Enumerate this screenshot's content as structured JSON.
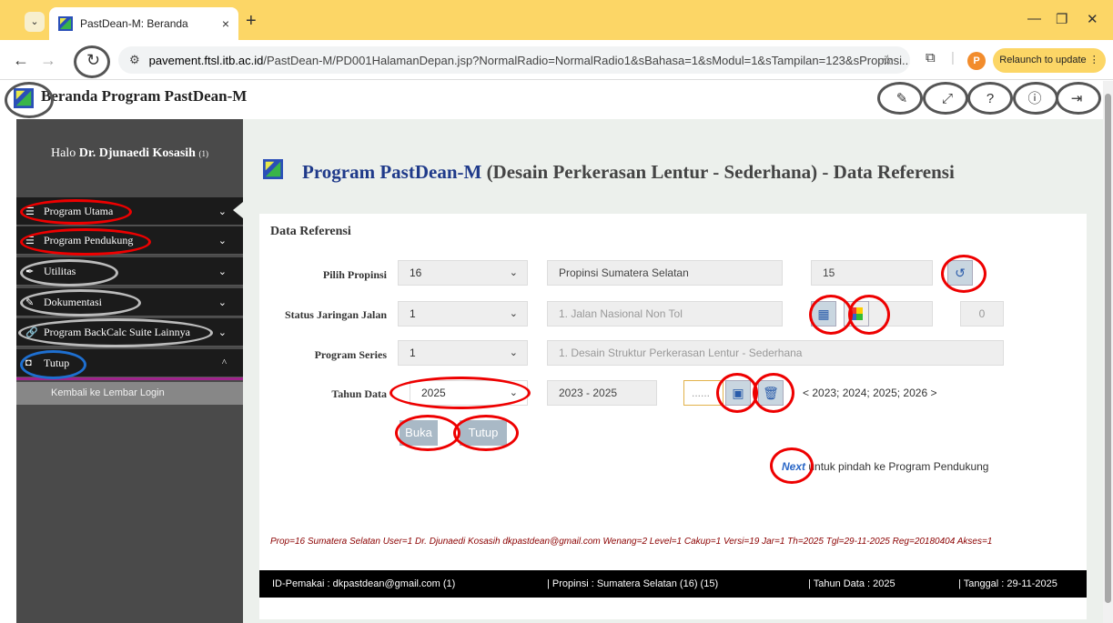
{
  "browser": {
    "tab_title": "PastDean-M: Beranda",
    "tab_close": "×",
    "new_tab": "+",
    "url_domain": "pavement.ftsl.itb.ac.id",
    "url_path": "/PastDean-M/PD001HalamanDepan.jsp?NormalRadio=NormalRadio1&sBahasa=1&sModul=1&sTampilan=123&sPropinsi...",
    "avatar_letter": "P",
    "relaunch_label": "Relaunch to update ⋮"
  },
  "app": {
    "title": "Beranda Program PastDean-M"
  },
  "sidebar": {
    "greeting": "Halo ",
    "user_name": "Dr. Djunaedi Kosasih",
    "user_id": "(1)",
    "items": [
      {
        "label": "Program Utama",
        "icon": "list-icon"
      },
      {
        "label": "Program Pendukung",
        "icon": "list-icon"
      },
      {
        "label": "Utilitas",
        "icon": "feather-icon"
      },
      {
        "label": "Dokumentasi",
        "icon": "pencil-icon"
      },
      {
        "label": "Program BackCalc Suite Lainnya",
        "icon": "link-icon"
      },
      {
        "label": "Tutup",
        "icon": "stop-icon"
      }
    ],
    "sub_item": "Kembali ke Lembar Login"
  },
  "main": {
    "title_program": "Program PastDean-M",
    "title_rest": " (Desain Perkerasan Lentur - Sederhana) - Data Referensi",
    "card_title": "Data Referensi",
    "rows": {
      "propinsi": {
        "label": "Pilih Propinsi",
        "select": "16",
        "name": "Propinsi Sumatera Selatan",
        "code": "15"
      },
      "status": {
        "label": "Status Jaringan Jalan",
        "select": "1",
        "name": "1. Jalan Nasional Non Tol",
        "value": "0"
      },
      "series": {
        "label": "Program Series",
        "select": "1",
        "name": "1. Desain Struktur Perkerasan Lentur - Sederhana"
      },
      "tahun": {
        "label": "Tahun Data",
        "select": "2025",
        "range": "2023 - 2025",
        "dots": "......",
        "years": "< 2023; 2024; 2025; 2026 >"
      }
    },
    "buka": "Buka",
    "tutup": "Tutup",
    "next_link": "Next",
    "next_text": " untuk pindah ke Program Pendukung",
    "status_line": "Prop=16 Sumatera Selatan  User=1 Dr. Djunaedi Kosasih dkpastdean@gmail.com  Wenang=2  Level=1  Cakup=1  Versi=19  Jar=1  Th=2025  Tgl=29-11-2025  Reg=20180404  Akses=1",
    "footer": {
      "user": "ID-Pemakai : dkpastdean@gmail.com (1)",
      "propinsi": "| Propinsi : Sumatera Selatan (16) (15)",
      "tahun": "| Tahun Data : 2025",
      "tanggal": "| Tanggal : 29-11-2025"
    }
  },
  "colors": {
    "accent_red": "#e00000",
    "sidebar_bg": "#4a4a4a",
    "menu_bg": "#1b1b1b",
    "brand_blue": "#1f3a8a"
  }
}
